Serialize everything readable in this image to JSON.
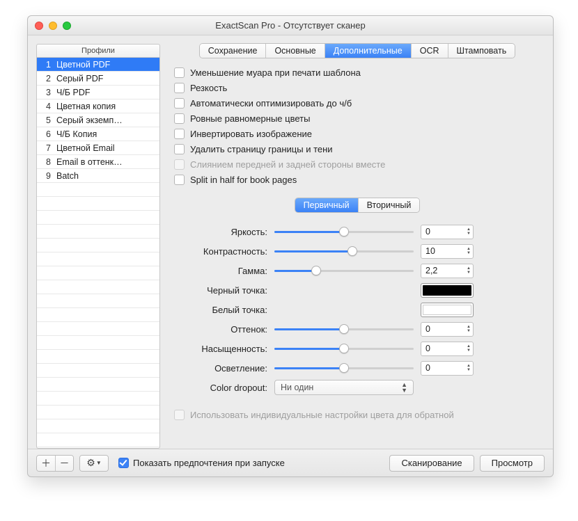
{
  "window": {
    "title": "ExactScan Pro - Отсутствует сканер"
  },
  "profiles": {
    "header": "Профили",
    "items": [
      {
        "num": "1",
        "name": "Цветной PDF",
        "selected": true
      },
      {
        "num": "2",
        "name": "Серый PDF"
      },
      {
        "num": "3",
        "name": "Ч/Б PDF"
      },
      {
        "num": "4",
        "name": "Цветная копия"
      },
      {
        "num": "5",
        "name": "Серый экземп…"
      },
      {
        "num": "6",
        "name": "Ч/Б Копия"
      },
      {
        "num": "7",
        "name": "Цветной Email"
      },
      {
        "num": "8",
        "name": "Email в оттенк…"
      },
      {
        "num": "9",
        "name": "Batch"
      }
    ]
  },
  "tabs": {
    "main": [
      {
        "label": "Сохранение"
      },
      {
        "label": "Основные"
      },
      {
        "label": "Дополнительные",
        "active": true
      },
      {
        "label": "OCR"
      },
      {
        "label": "Штамповать"
      }
    ],
    "sub": [
      {
        "label": "Первичный",
        "active": true
      },
      {
        "label": "Вторичный"
      }
    ]
  },
  "checks": [
    {
      "label": "Уменьшение муара при печати шаблона"
    },
    {
      "label": "Резкость"
    },
    {
      "label": "Автоматически оптимизировать до ч/б"
    },
    {
      "label": "Ровные равномерные цветы"
    },
    {
      "label": "Инвертировать изображение"
    },
    {
      "label": "Удалить страницу границы и тени"
    },
    {
      "label": "Слиянием передней и задней стороны вместе",
      "disabled": true
    },
    {
      "label": "Split in half for book pages"
    }
  ],
  "sliders": {
    "brightness": {
      "label": "Яркость:",
      "value": "0",
      "pos": 50
    },
    "contrast": {
      "label": "Контрастность:",
      "value": "10",
      "pos": 56
    },
    "gamma": {
      "label": "Гамма:",
      "value": "2,2",
      "pos": 30
    },
    "blackpoint": {
      "label": "Черный точка:",
      "color": "#000000"
    },
    "whitepoint": {
      "label": "Белый точка:",
      "color": "#ffffff"
    },
    "hue": {
      "label": "Оттенок:",
      "value": "0",
      "pos": 50
    },
    "saturation": {
      "label": "Насыщенность:",
      "value": "0",
      "pos": 50
    },
    "lightness": {
      "label": "Осветление:",
      "value": "0",
      "pos": 50
    },
    "dropout": {
      "label": "Color dropout:",
      "selected": "Ни один"
    }
  },
  "individual_label": "Использовать индивидуальные настройки цвета для обратной",
  "footer": {
    "startup": "Показать предпочтения при запуске",
    "scan": "Сканирование",
    "preview": "Просмотр"
  }
}
